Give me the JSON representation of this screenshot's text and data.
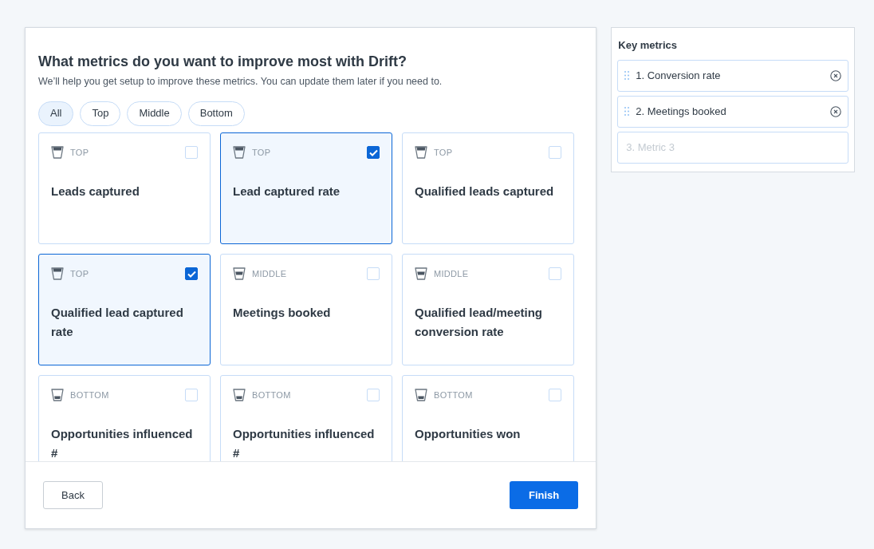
{
  "main": {
    "title": "What metrics do you want to improve most with Drift?",
    "subtitle": "We’ll help you get setup to improve these metrics. You can update them later if you need to.",
    "filters": [
      {
        "label": "All",
        "selected": true
      },
      {
        "label": "Top",
        "selected": false
      },
      {
        "label": "Middle",
        "selected": false
      },
      {
        "label": "Bottom",
        "selected": false
      }
    ],
    "metrics": [
      {
        "kind": "top",
        "stage_label": "TOP",
        "name": "Leads captured",
        "checked": false
      },
      {
        "kind": "top",
        "stage_label": "TOP",
        "name": "Lead captured rate",
        "checked": true
      },
      {
        "kind": "top",
        "stage_label": "TOP",
        "name": "Qualified leads captured",
        "checked": false
      },
      {
        "kind": "top",
        "stage_label": "TOP",
        "name": "Qualified lead captured rate",
        "checked": true
      },
      {
        "kind": "middle",
        "stage_label": "MIDDLE",
        "name": "Meetings booked",
        "checked": false
      },
      {
        "kind": "middle",
        "stage_label": "MIDDLE",
        "name": "Qualified lead/meeting conversion rate",
        "checked": false
      },
      {
        "kind": "bottom",
        "stage_label": "BOTTOM",
        "name": "Opportunities influenced #",
        "checked": false
      },
      {
        "kind": "bottom",
        "stage_label": "BOTTOM",
        "name": "Opportunities influenced #",
        "checked": false
      },
      {
        "kind": "bottom",
        "stage_label": "BOTTOM",
        "name": "Opportunities won",
        "checked": false
      }
    ],
    "back_button": "Back",
    "finish_button": "Finish"
  },
  "key_metrics": {
    "title": "Key metrics",
    "items": [
      {
        "kind": "filled",
        "label": "1. Conversion rate"
      },
      {
        "kind": "filled",
        "label": "2. Meetings booked"
      },
      {
        "kind": "empty",
        "placeholder": "3. Metric 3"
      }
    ]
  }
}
